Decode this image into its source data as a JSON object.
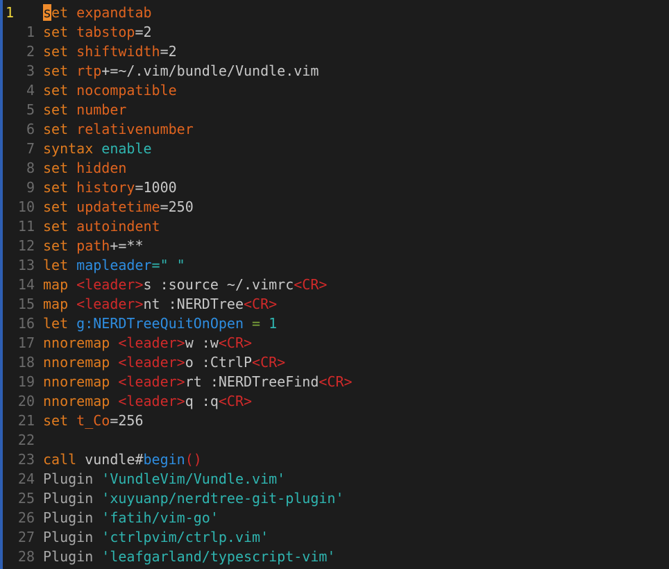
{
  "editor": {
    "cursor_line_number": "1",
    "lines": [
      {
        "num": "1",
        "current": true,
        "tokens": [
          {
            "t": "s",
            "c": "cursor"
          },
          {
            "t": "et ",
            "c": "kw"
          },
          {
            "t": "expandtab",
            "c": "opt"
          }
        ]
      },
      {
        "num": "1",
        "tokens": [
          {
            "t": "set ",
            "c": "kw"
          },
          {
            "t": "tabstop",
            "c": "opt"
          },
          {
            "t": "=2",
            "c": "val"
          }
        ]
      },
      {
        "num": "2",
        "tokens": [
          {
            "t": "set ",
            "c": "kw"
          },
          {
            "t": "shiftwidth",
            "c": "opt"
          },
          {
            "t": "=2",
            "c": "val"
          }
        ]
      },
      {
        "num": "3",
        "tokens": [
          {
            "t": "set ",
            "c": "kw"
          },
          {
            "t": "rtp",
            "c": "opt"
          },
          {
            "t": "+=~/.vim/bundle/Vundle.vim",
            "c": "val"
          }
        ]
      },
      {
        "num": "4",
        "tokens": [
          {
            "t": "set ",
            "c": "kw"
          },
          {
            "t": "nocompatible",
            "c": "opt"
          }
        ]
      },
      {
        "num": "5",
        "tokens": [
          {
            "t": "set ",
            "c": "kw"
          },
          {
            "t": "number",
            "c": "opt"
          }
        ]
      },
      {
        "num": "6",
        "tokens": [
          {
            "t": "set ",
            "c": "kw"
          },
          {
            "t": "relativenumber",
            "c": "opt"
          }
        ]
      },
      {
        "num": "7",
        "tokens": [
          {
            "t": "syntax ",
            "c": "kw"
          },
          {
            "t": "enable",
            "c": "str"
          }
        ]
      },
      {
        "num": "8",
        "tokens": [
          {
            "t": "set ",
            "c": "kw"
          },
          {
            "t": "hidden",
            "c": "opt"
          }
        ]
      },
      {
        "num": "9",
        "tokens": [
          {
            "t": "set ",
            "c": "kw"
          },
          {
            "t": "history",
            "c": "opt"
          },
          {
            "t": "=1000",
            "c": "val"
          }
        ]
      },
      {
        "num": "10",
        "tokens": [
          {
            "t": "set ",
            "c": "kw"
          },
          {
            "t": "updatetime",
            "c": "opt"
          },
          {
            "t": "=250",
            "c": "val"
          }
        ]
      },
      {
        "num": "11",
        "tokens": [
          {
            "t": "set ",
            "c": "kw"
          },
          {
            "t": "autoindent",
            "c": "opt"
          }
        ]
      },
      {
        "num": "12",
        "tokens": [
          {
            "t": "set ",
            "c": "kw"
          },
          {
            "t": "path",
            "c": "opt"
          },
          {
            "t": "+=**",
            "c": "val"
          }
        ]
      },
      {
        "num": "13",
        "tokens": [
          {
            "t": "let ",
            "c": "kw"
          },
          {
            "t": "mapleader",
            "c": "fn"
          },
          {
            "t": "=\" \"",
            "c": "str"
          }
        ]
      },
      {
        "num": "14",
        "tokens": [
          {
            "t": "map ",
            "c": "kw"
          },
          {
            "t": "<leader>",
            "c": "key"
          },
          {
            "t": "s :source ~/.vimrc",
            "c": "plain"
          },
          {
            "t": "<CR>",
            "c": "key"
          }
        ]
      },
      {
        "num": "15",
        "tokens": [
          {
            "t": "map ",
            "c": "kw"
          },
          {
            "t": "<leader>",
            "c": "key"
          },
          {
            "t": "nt :NERDTree",
            "c": "plain"
          },
          {
            "t": "<CR>",
            "c": "key"
          }
        ]
      },
      {
        "num": "16",
        "tokens": [
          {
            "t": "let ",
            "c": "kw"
          },
          {
            "t": "g:NERDTreeQuitOnOpen",
            "c": "fn"
          },
          {
            "t": " = ",
            "c": "eq"
          },
          {
            "t": "1",
            "c": "num"
          }
        ]
      },
      {
        "num": "17",
        "tokens": [
          {
            "t": "nnoremap ",
            "c": "kw"
          },
          {
            "t": "<leader>",
            "c": "key"
          },
          {
            "t": "w :w",
            "c": "plain"
          },
          {
            "t": "<CR>",
            "c": "key"
          }
        ]
      },
      {
        "num": "18",
        "tokens": [
          {
            "t": "nnoremap ",
            "c": "kw"
          },
          {
            "t": "<leader>",
            "c": "key"
          },
          {
            "t": "o :CtrlP",
            "c": "plain"
          },
          {
            "t": "<CR>",
            "c": "key"
          }
        ]
      },
      {
        "num": "19",
        "tokens": [
          {
            "t": "nnoremap ",
            "c": "kw"
          },
          {
            "t": "<leader>",
            "c": "key"
          },
          {
            "t": "rt :NERDTreeFind",
            "c": "plain"
          },
          {
            "t": "<CR>",
            "c": "key"
          }
        ]
      },
      {
        "num": "20",
        "tokens": [
          {
            "t": "nnoremap ",
            "c": "kw"
          },
          {
            "t": "<leader>",
            "c": "key"
          },
          {
            "t": "q :q",
            "c": "plain"
          },
          {
            "t": "<CR>",
            "c": "key"
          }
        ]
      },
      {
        "num": "21",
        "tokens": [
          {
            "t": "set ",
            "c": "kw"
          },
          {
            "t": "t_Co",
            "c": "opt"
          },
          {
            "t": "=256",
            "c": "val"
          }
        ]
      },
      {
        "num": "22",
        "tokens": []
      },
      {
        "num": "23",
        "tokens": [
          {
            "t": "call ",
            "c": "kw"
          },
          {
            "t": "vundle#",
            "c": "plain"
          },
          {
            "t": "begin",
            "c": "fn"
          },
          {
            "t": "()",
            "c": "paren"
          }
        ]
      },
      {
        "num": "24",
        "tokens": [
          {
            "t": "Plugin ",
            "c": "muted"
          },
          {
            "t": "'VundleVim/Vundle.vim'",
            "c": "str"
          }
        ]
      },
      {
        "num": "25",
        "tokens": [
          {
            "t": "Plugin ",
            "c": "muted"
          },
          {
            "t": "'xuyuanp/nerdtree-git-plugin'",
            "c": "str"
          }
        ]
      },
      {
        "num": "26",
        "tokens": [
          {
            "t": "Plugin ",
            "c": "muted"
          },
          {
            "t": "'fatih/vim-go'",
            "c": "str"
          }
        ]
      },
      {
        "num": "27",
        "tokens": [
          {
            "t": "Plugin ",
            "c": "muted"
          },
          {
            "t": "'ctrlpvim/ctrlp.vim'",
            "c": "str"
          }
        ]
      },
      {
        "num": "28",
        "tokens": [
          {
            "t": "Plugin ",
            "c": "muted"
          },
          {
            "t": "'leafgarland/typescript-vim'",
            "c": "str"
          }
        ]
      }
    ]
  },
  "colors": {
    "background": "#1c1c1c",
    "keyword": "#e07b1f",
    "option": "#e0641f",
    "string": "#2fb5b0",
    "special_key": "#d12a2a",
    "identifier": "#2e8de0",
    "current_line_number": "#f0d63a",
    "cursor": "#ef8b2c"
  }
}
